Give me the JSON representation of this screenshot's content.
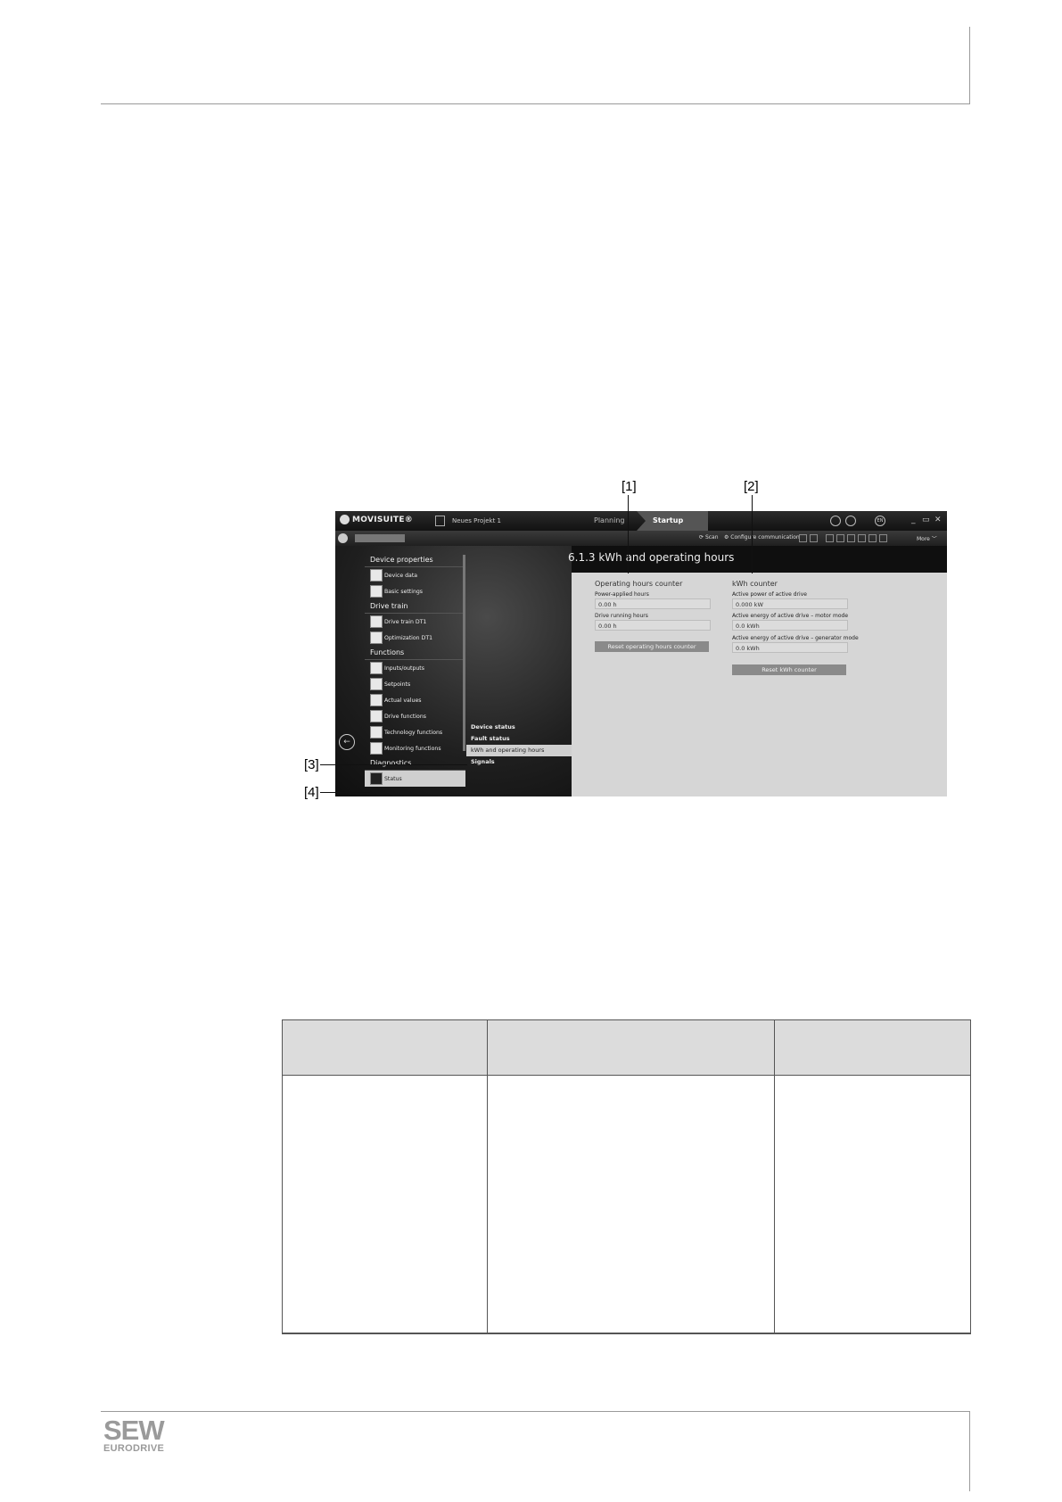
{
  "callouts": {
    "c1": "[1]",
    "c2": "[2]",
    "c3": "[3]",
    "c4": "[4]"
  },
  "app": {
    "logo": "MOVISUITE®",
    "project": "Neues Projekt 1",
    "tabs": [
      "Planning",
      "Startup"
    ],
    "toolbar": {
      "scan": "Scan",
      "configure": "Configure communication",
      "more": "More"
    }
  },
  "nav": {
    "device_properties": "Device properties",
    "device_data": "Device data",
    "basic_settings": "Basic settings",
    "drive_train": "Drive train",
    "drive_train_dt1": "Drive train DT1",
    "optimization_dt1": "Optimization DT1",
    "functions": "Functions",
    "inputs_outputs": "Inputs/outputs",
    "setpoints": "Setpoints",
    "actual_values": "Actual values",
    "drive_functions": "Drive functions",
    "technology_functions": "Technology functions",
    "monitoring_functions": "Monitoring functions",
    "diagnostics": "Diagnostics",
    "status": "Status"
  },
  "subnav": [
    "Device status",
    "Fault status",
    "kWh and operating hours",
    "Signals"
  ],
  "content": {
    "title": "6.1.3 kWh and operating hours",
    "operating": {
      "title": "Operating hours counter",
      "power_label": "Power-applied hours",
      "power_value": "0.00 h",
      "running_label": "Drive running hours",
      "running_value": "0.00 h",
      "reset": "Reset operating hours counter"
    },
    "kwh": {
      "title": "kWh counter",
      "active_power_label": "Active power of active drive",
      "active_power_value": "0.000 kW",
      "motor_label": "Active energy of active drive – motor mode",
      "motor_value": "0.0 kWh",
      "generator_label": "Active energy of active drive – generator mode",
      "generator_value": "0.0 kWh",
      "reset": "Reset kWh counter"
    }
  },
  "footer": {
    "brand": "SEW",
    "brand_sub": "EURODRIVE"
  }
}
